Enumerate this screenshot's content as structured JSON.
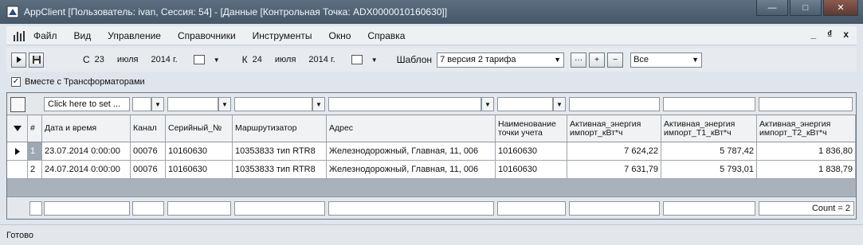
{
  "window": {
    "title": "AppClient  [Пользователь: ivan, Сессия: 54] - [Данные [Контрольная Точка: ADX0000010160630]]",
    "minimize": "—",
    "maximize": "□",
    "close": "✕"
  },
  "menu": {
    "items": [
      "Файл",
      "Вид",
      "Управление",
      "Справочники",
      "Инструменты",
      "Окно",
      "Справка"
    ],
    "right": [
      "_",
      "₫",
      "x"
    ]
  },
  "toolbar": {
    "from_label": "С",
    "from_day": "23",
    "from_month": "июля",
    "from_year": "2014 г.",
    "to_label": "К",
    "to_day": "24",
    "to_month": "июля",
    "to_year": "2014 г.",
    "template_label": "Шаблон",
    "template_value": "7 версия 2 тарифа",
    "ellipsis": "···",
    "plus": "+",
    "minus": "−",
    "filter_value": "Все"
  },
  "options": {
    "with_transformers_label": "Вместе с Трансформаторами",
    "with_transformers_checked": true
  },
  "grid": {
    "filter_placeholder": "Click here to set ...",
    "columns": [
      "#",
      "Дата и время",
      "Канал",
      "Серийный_№",
      "Маршрутизатор",
      "Адрес",
      "Наименование точки учета",
      "Активная_энергия импорт_кВт*ч",
      "Активная_энергия импорт_Т1_кВт*ч",
      "Активная_энергия импорт_Т2_кВт*ч"
    ],
    "rows": [
      [
        "1",
        "23.07.2014 0:00:00",
        "00076",
        "10160630",
        "10353833 тип RTR8",
        "Железнодорожный, Главная, 11, 006",
        "10160630",
        "7 624,22",
        "5 787,42",
        "1 836,80"
      ],
      [
        "2",
        "24.07.2014 0:00:00",
        "00076",
        "10160630",
        "10353833 тип RTR8",
        "Железнодорожный, Главная, 11, 006",
        "10160630",
        "7 631,79",
        "5 793,01",
        "1 838,79"
      ]
    ],
    "summary_count": "Count = 2"
  },
  "status": {
    "text": "Готово"
  }
}
